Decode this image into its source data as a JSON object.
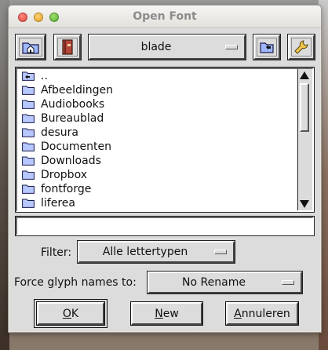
{
  "window": {
    "title": "Open Font"
  },
  "toolbar": {
    "home_icon": "home-folder-icon",
    "bookmarks_icon": "bookmarks-book-icon",
    "directory": "blade",
    "parent_icon": "parent-folder-icon",
    "settings_icon": "wrench-icon"
  },
  "file_list": {
    "items": [
      {
        "label": "..",
        "icon": "parent-folder-icon"
      },
      {
        "label": "Afbeeldingen",
        "icon": "folder-icon"
      },
      {
        "label": "Audiobooks",
        "icon": "folder-icon"
      },
      {
        "label": "Bureaublad",
        "icon": "folder-icon"
      },
      {
        "label": "desura",
        "icon": "folder-icon"
      },
      {
        "label": "Documenten",
        "icon": "folder-icon"
      },
      {
        "label": "Downloads",
        "icon": "folder-icon"
      },
      {
        "label": "Dropbox",
        "icon": "folder-icon"
      },
      {
        "label": "fontforge",
        "icon": "folder-icon"
      },
      {
        "label": "liferea",
        "icon": "folder-icon"
      }
    ]
  },
  "filename": {
    "value": ""
  },
  "filter": {
    "label": "Filter:",
    "value": "Alle lettertypen"
  },
  "glyph_names": {
    "label": "Force glyph names to:",
    "value": "No Rename"
  },
  "buttons": {
    "ok": {
      "mnemonic": "O",
      "rest": "K"
    },
    "new": {
      "mnemonic": "N",
      "rest": "ew"
    },
    "cancel": {
      "mnemonic": "A",
      "rest": "nnuleren"
    }
  }
}
